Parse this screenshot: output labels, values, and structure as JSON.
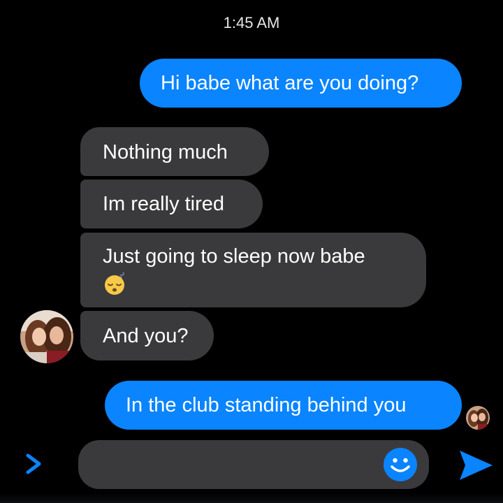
{
  "header": {
    "timestamp": "1:45 AM"
  },
  "messages": [
    {
      "direction": "outgoing",
      "text": "Hi babe what are you doing?"
    },
    {
      "direction": "incoming",
      "text": "Nothing much"
    },
    {
      "direction": "incoming",
      "text": "Im really tired"
    },
    {
      "direction": "incoming",
      "text": "Just going to sleep now babe",
      "emoji": "sleeping-face"
    },
    {
      "direction": "incoming",
      "text": "And you?"
    },
    {
      "direction": "outgoing",
      "text": "In the club standing behind you"
    }
  ],
  "composer": {
    "expand_icon": "chevron-right-icon",
    "emoji_icon": "smiley-icon",
    "send_icon": "send-icon"
  },
  "colors": {
    "background": "#000000",
    "outgoing_bubble": "#0a84ff",
    "incoming_bubble": "#3a3a3c",
    "accent": "#0a84ff"
  }
}
